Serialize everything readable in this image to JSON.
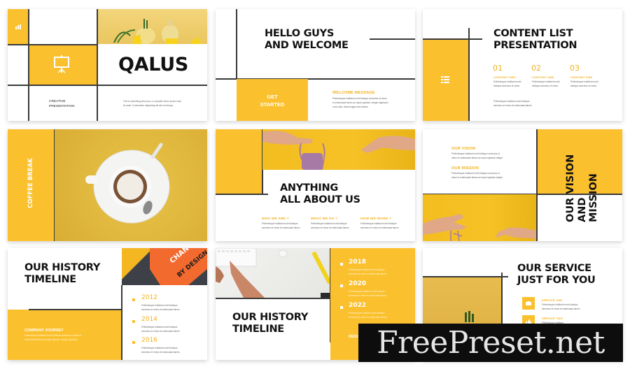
{
  "colors": {
    "accent": "#FBC02D",
    "accent_text": "#F2B21C",
    "dark": "#111111",
    "line": "#3a3a3a",
    "watermark_bg": "#0d0d0d"
  },
  "slides": {
    "cover": {
      "title": "QALUS",
      "subtitle_line1": "CREATIVE",
      "subtitle_line2": "PRESENTATION",
      "desc_line1": "This is something about you, a complete lorem ipsum dolor",
      "desc_line2": "sit amet. Consectetur adipiscing elit sed do tempor",
      "icons": [
        "bar-chart-icon",
        "presentation-board-icon"
      ]
    },
    "welcome": {
      "title_line1": "HELLO GUYS",
      "title_line2": "AND WELCOME",
      "button": "GET STARTED",
      "button_line1": "GET",
      "button_line2": "STARTED",
      "heading": "WELCOME MESSAGE",
      "body_line1": "Pellentesque habitant morbi tristique senectus et netus",
      "body_line2": "et malesuada fames ac turpis egestas. Integer dignissim",
      "body_line3": "urna nulla, vitae feugiat erat lobortis."
    },
    "content_list": {
      "title_line1": "CONTENT LIST",
      "title_line2": "PRESENTATION",
      "icon": "list-icon",
      "items": [
        {
          "num": "01",
          "label": "CONTENT ONE",
          "line1": "Pellentesque habitant morbi",
          "line2": "tristique senectus et netus"
        },
        {
          "num": "02",
          "label": "CONTENT ONE",
          "line1": "Pellentesque habitant morbi",
          "line2": "tristique senectus et netus"
        },
        {
          "num": "03",
          "label": "CONTENT ONE",
          "line1": "Pellentesque habitant morbi",
          "line2": "tristique senectus et netus"
        }
      ],
      "footer_line1": "Pellentesque habitant morbi tristique",
      "footer_line2": "senectus et netus et malesuada fames"
    },
    "coffee": {
      "label": "COFFEE BREAK"
    },
    "about": {
      "title_line1": "ANYTHING",
      "title_line2": "ALL ABOUT US",
      "columns": [
        {
          "heading": "WHO WE ARE ?",
          "line1": "Pellentesque habitant morbi tristique",
          "line2": "senectus et netus et malesuada fames"
        },
        {
          "heading": "WHAT WE DO ?",
          "line1": "Pellentesque habitant morbi tristique",
          "line2": "senectus et netus et malesuada fames"
        },
        {
          "heading": "HOW WE WORK ?",
          "line1": "Pellentesque habitant morbi tristique",
          "line2": "senectus et netus et malesuada fames"
        }
      ]
    },
    "vision": {
      "title_line1": "OUR VISION",
      "title_line2": "AND MISSION",
      "vision_heading": "OUR VISION",
      "vision_line1": "Pellentesque habitant morbi tristique senectus et",
      "vision_line2": "netus et malesuada fames ac turpis egestas integer",
      "mission_heading": "OUR MISSION",
      "mission_line1": "Pellentesque habitant morbi tristique senectus et",
      "mission_line2": "netus et malesuada fames ac turpis egestas integer"
    },
    "history1": {
      "title_line1": "OUR HISTORY",
      "title_line2": "TIMELINE",
      "journey_heading": "COMPANY JOURNEY",
      "journey_line1": "Pellentesque habitant morbi tristique senectus et netus et",
      "journey_line2": "malesuada fames ac turpis egestas. Integer dignissim",
      "book_text_line1": "CHANGE",
      "book_text_line2": "BY DESIGN",
      "timeline": [
        {
          "year": "2012",
          "line1": "Pellentesque habitant morbi tristique",
          "line2": "senectus et netus et malesuada fames"
        },
        {
          "year": "2014",
          "line1": "Pellentesque habitant morbi tristique",
          "line2": "senectus et netus et malesuada fames"
        },
        {
          "year": "2016",
          "line1": "Pellentesque habitant morbi tristique",
          "line2": "senectus et netus et malesuada fames"
        }
      ]
    },
    "history2": {
      "title_line1": "OUR HISTORY",
      "title_line2": "TIMELINE",
      "desc_heading": "DESC",
      "timeline": [
        {
          "year": "2018",
          "line1": "Pellentesque habitant morbi tristique",
          "line2": "senectus et netus et malesuada fames"
        },
        {
          "year": "2020",
          "line1": "Pellentesque habitant morbi tristique",
          "line2": "senectus et netus et malesuada fames"
        },
        {
          "year": "2022",
          "line1": "Pellentesque habitant morbi tristique",
          "line2": "senectus et netus et malesuada fames"
        }
      ]
    },
    "service": {
      "title_line1": "OUR SERVICE",
      "title_line2": "JUST FOR YOU",
      "items": [
        {
          "label": "SERVICE ONE",
          "line1": "Pellentesque habitant morbi tristique",
          "line2": "senectus et netus et malesuada fames",
          "icon": "briefcase-icon"
        },
        {
          "label": "SERVICE TWO",
          "line1": "Pellentesque habitant",
          "line2": "",
          "icon": "thumbs-up-icon"
        }
      ]
    }
  },
  "watermark": {
    "text": "FreePreset.net"
  }
}
